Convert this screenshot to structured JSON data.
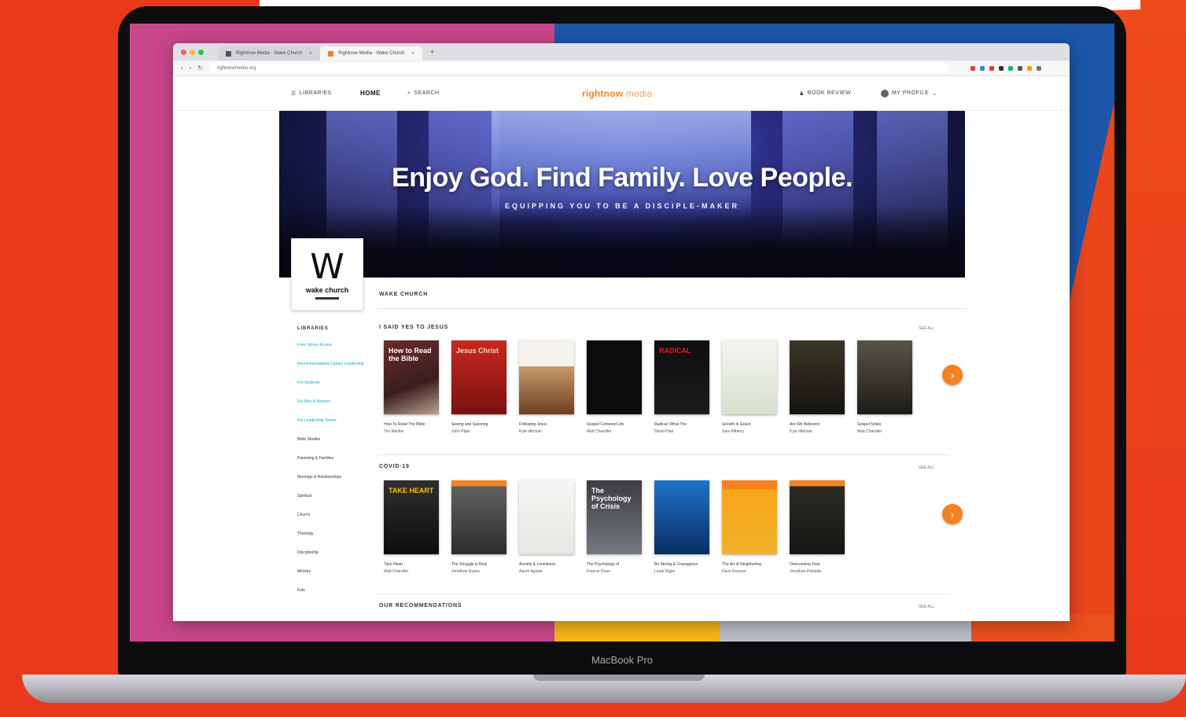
{
  "browser": {
    "tabs": [
      {
        "label": "Rightnow Media - Wake Church",
        "active": false
      },
      {
        "label": "Rightnow Media - Wake Church",
        "active": true
      }
    ],
    "new_tab": "+",
    "url": "rightnowmedia.org",
    "nav": {
      "back": "‹",
      "forward": "›",
      "reload": "↻"
    }
  },
  "header": {
    "libraries": "Libraries",
    "home": "HOME",
    "search": "Search",
    "brand_main": "rightnow",
    "brand_sub": "media",
    "user_link": "Book Review",
    "profile": "My Profile"
  },
  "hero": {
    "title": "Enjoy God. Find Family. Love People.",
    "subtitle": "EQUIPPING YOU TO BE A DISCIPLE-MAKER"
  },
  "church": {
    "logo_letter": "W",
    "logo_name": "wake church",
    "name": "WAKE CHURCH"
  },
  "sidebar": {
    "title": "LIBRARIES",
    "items": [
      {
        "label": "Free Library Access",
        "highlight": true
      },
      {
        "label": "Recommendations Library Leadership",
        "highlight": true
      },
      {
        "label": "For Students",
        "highlight": true
      },
      {
        "label": "For Men & Women",
        "highlight": true
      },
      {
        "label": "For Leadership Teams",
        "highlight": true
      },
      {
        "label": "Bible Studies",
        "highlight": false
      },
      {
        "label": "Parenting & Families",
        "highlight": false
      },
      {
        "label": "Marriage & Relationships",
        "highlight": false
      },
      {
        "label": "Spiritual",
        "highlight": false
      },
      {
        "label": "Church",
        "highlight": false
      },
      {
        "label": "Theology",
        "highlight": false
      },
      {
        "label": "Discipleship",
        "highlight": false
      },
      {
        "label": "Ministry",
        "highlight": false
      },
      {
        "label": "Kids",
        "highlight": false
      }
    ]
  },
  "rows": [
    {
      "title": "I SAID YES TO JESUS",
      "see_all": "SEE ALL",
      "books": [
        {
          "cover_text": "How to Read the Bible",
          "title": "How To Read The Bible",
          "author": "Tim Mackie"
        },
        {
          "cover_text": "Jesus Christ",
          "title": "Seeing and Savoring",
          "author": "John Piper"
        },
        {
          "cover_text": "",
          "title": "Following Jesus",
          "author": "Kyle Idleman"
        },
        {
          "cover_text": "",
          "title": "Gospel Centered Life",
          "author": "Matt Chandler"
        },
        {
          "cover_text": "RADICAL",
          "title": "Radical: What The",
          "author": "David Platt"
        },
        {
          "cover_text": "",
          "title": "Growth in Grace",
          "author": "Sam Allberry"
        },
        {
          "cover_text": "",
          "title": "Are We Believers",
          "author": "Kyle Idleman"
        },
        {
          "cover_text": "",
          "title": "Gospel Notes",
          "author": "Matt Chandler"
        }
      ]
    },
    {
      "title": "COVID-19",
      "see_all": "SEE ALL",
      "books": [
        {
          "cover_text": "TAKE HEART",
          "title": "Take Heart",
          "author": "Matt Chandler"
        },
        {
          "cover_text": "",
          "title": "The Struggle is Real",
          "author": "Jonathan Evans"
        },
        {
          "cover_text": "",
          "title": "Anxiety & Loneliness",
          "author": "Aaron Aguilar"
        },
        {
          "cover_text": "The Psychology of Crisis",
          "title": "The Psychology of",
          "author": "Francis Chan"
        },
        {
          "cover_text": "",
          "title": "Be Strong & Courageous",
          "author": "Louie Giglio"
        },
        {
          "cover_text": "",
          "title": "The Art of Neighboring",
          "author": "Dave Runyon"
        },
        {
          "cover_text": "",
          "title": "Overcoming Fear",
          "author": "Jonathan Pokluda"
        }
      ]
    },
    {
      "title": "OUR RECOMMENDATIONS",
      "see_all": "SEE ALL",
      "books": []
    }
  ],
  "next_arrow": "›",
  "device": {
    "label": "MacBook Pro"
  },
  "colors": {
    "accent": "#f58220",
    "link": "#1ca6c9",
    "background": "#e8391c"
  }
}
